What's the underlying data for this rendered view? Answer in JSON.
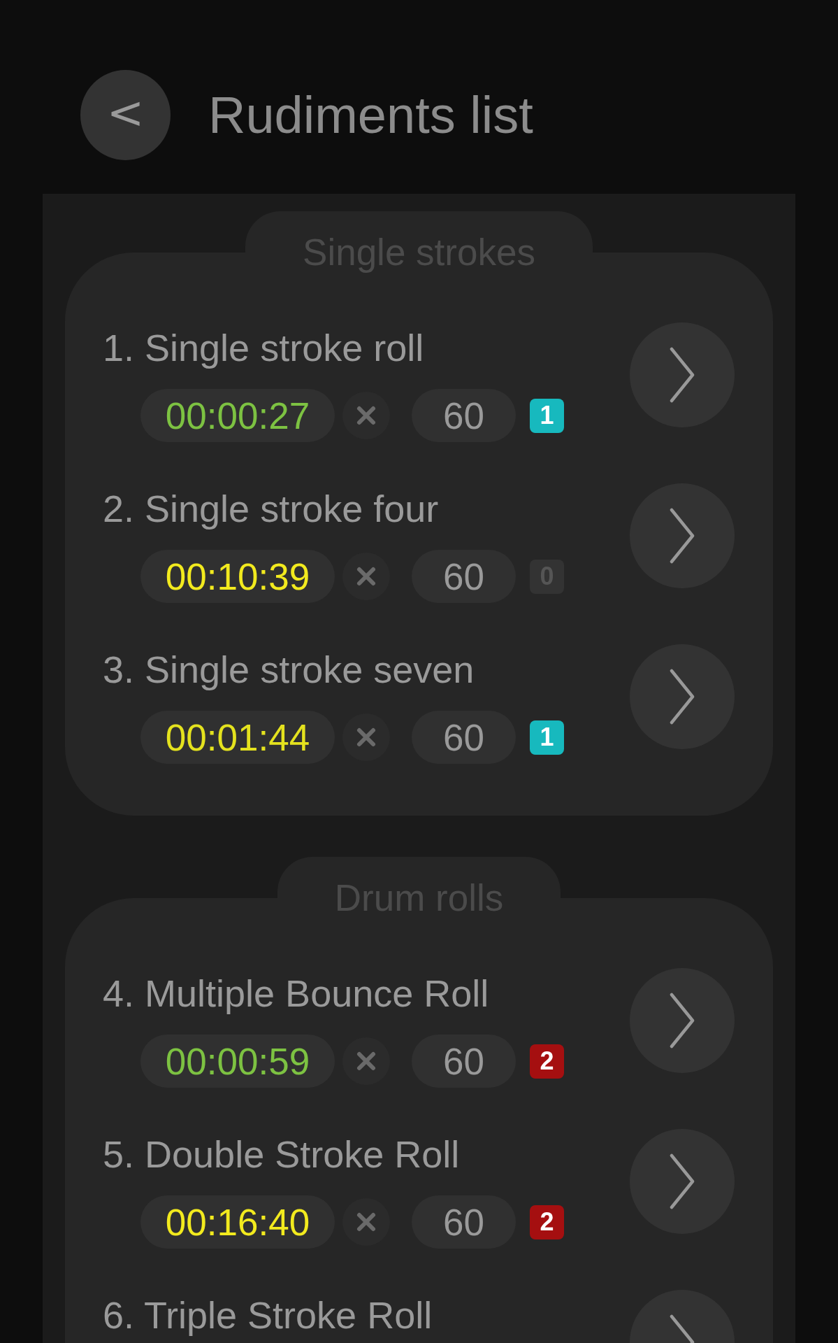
{
  "header": {
    "back_button": "<",
    "title": "Rudiments list"
  },
  "sections": [
    {
      "title": "Single strokes",
      "items": [
        {
          "name": "1. Single stroke roll",
          "time": {
            "text": "00:00:27",
            "color": "#7dc242"
          },
          "value": "60",
          "badge": {
            "text": "1",
            "color": "#17b9be"
          }
        },
        {
          "name": "2. Single stroke four",
          "time": {
            "text": "00:10:39",
            "color": "#f2ea1e"
          },
          "value": "60",
          "badge": {
            "text": "0",
            "color": "#333333"
          }
        },
        {
          "name": "3. Single stroke seven",
          "time": {
            "text": "00:01:44",
            "color": "#e4e21e"
          },
          "value": "60",
          "badge": {
            "text": "1",
            "color": "#17b9be"
          }
        }
      ]
    },
    {
      "title": "Drum rolls",
      "items": [
        {
          "name": "4. Multiple Bounce Roll",
          "time": {
            "text": "00:00:59",
            "color": "#7dc242"
          },
          "value": "60",
          "badge": {
            "text": "2",
            "color": "#a50f10"
          }
        },
        {
          "name": "5. Double Stroke Roll",
          "time": {
            "text": "00:16:40",
            "color": "#f2ea1e"
          },
          "value": "60",
          "badge": {
            "text": "2",
            "color": "#a50f10"
          }
        },
        {
          "name": "6. Triple Stroke Roll"
        }
      ]
    }
  ]
}
